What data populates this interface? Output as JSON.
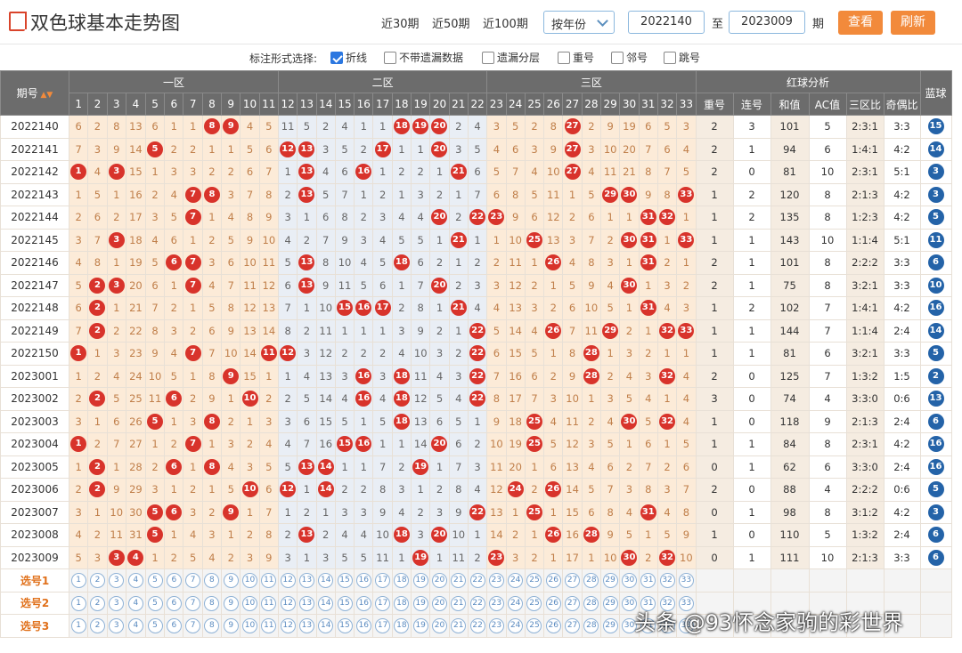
{
  "header": {
    "title": "双色球基本走势图",
    "ranges": [
      "近30期",
      "近50期",
      "近100期"
    ],
    "select": "按年份",
    "from": "2022140",
    "to_label": "至",
    "to": "2023009",
    "unit": "期",
    "view": "查看",
    "refresh": "刷新"
  },
  "options": {
    "label": "标注形式选择:",
    "items": [
      {
        "label": "折线",
        "checked": true
      },
      {
        "label": "不带遗漏数据",
        "checked": false
      },
      {
        "label": "遗漏分层",
        "checked": false
      },
      {
        "label": "重号",
        "checked": false
      },
      {
        "label": "邻号",
        "checked": false
      },
      {
        "label": "跳号",
        "checked": false
      }
    ]
  },
  "table": {
    "period_header": "期号",
    "zones": [
      "一区",
      "二区",
      "三区"
    ],
    "analysis_header": "红球分析",
    "blue_header": "蓝球",
    "analysis_cols": [
      "重号",
      "连号",
      "和值",
      "AC值",
      "三区比",
      "奇偶比"
    ],
    "select_rows": [
      "选号1",
      "选号2",
      "选号3"
    ],
    "rows": [
      {
        "p": "2022140",
        "r": [
          6,
          2,
          8,
          13,
          6,
          1,
          1,
          "#8",
          "#9",
          4,
          5,
          11,
          5,
          2,
          4,
          1,
          1,
          "#18",
          "#19",
          "#20",
          2,
          4,
          3,
          5,
          2,
          8,
          "#27",
          2,
          9,
          19,
          6,
          5,
          3
        ],
        "a": [
          2,
          3,
          101,
          5,
          "2:3:1",
          "3:3"
        ],
        "b": 15
      },
      {
        "p": "2022141",
        "r": [
          7,
          3,
          9,
          14,
          "#5",
          2,
          2,
          1,
          1,
          5,
          6,
          "#12",
          "#13",
          3,
          5,
          2,
          "#17",
          1,
          1,
          "#20",
          3,
          5,
          4,
          6,
          3,
          9,
          "#27",
          3,
          10,
          20,
          7,
          6,
          4
        ],
        "a": [
          2,
          1,
          94,
          6,
          "1:4:1",
          "4:2"
        ],
        "b": 14
      },
      {
        "p": "2022142",
        "r": [
          "#1",
          4,
          "#3",
          15,
          1,
          3,
          3,
          2,
          2,
          6,
          7,
          1,
          "#13",
          4,
          6,
          "#16",
          1,
          2,
          2,
          1,
          "#21",
          6,
          5,
          7,
          4,
          10,
          "#27",
          4,
          11,
          21,
          8,
          7,
          5
        ],
        "a": [
          2,
          0,
          81,
          10,
          "2:3:1",
          "5:1"
        ],
        "b": 3
      },
      {
        "p": "2022143",
        "r": [
          1,
          5,
          1,
          16,
          2,
          4,
          "#7",
          "#8",
          3,
          7,
          8,
          2,
          "#13",
          5,
          7,
          1,
          2,
          1,
          3,
          2,
          1,
          7,
          6,
          8,
          5,
          11,
          1,
          5,
          "#29",
          "#30",
          9,
          8,
          "#33"
        ],
        "a": [
          1,
          2,
          120,
          8,
          "2:1:3",
          "4:2"
        ],
        "b": 3
      },
      {
        "p": "2022144",
        "r": [
          2,
          6,
          2,
          17,
          3,
          5,
          "#7",
          1,
          4,
          8,
          9,
          3,
          1,
          6,
          8,
          2,
          3,
          4,
          4,
          "#20",
          2,
          "#22",
          "#23",
          9,
          6,
          12,
          2,
          6,
          1,
          1,
          "#31",
          "#32",
          1
        ],
        "a": [
          1,
          2,
          135,
          8,
          "1:2:3",
          "4:2"
        ],
        "b": 5
      },
      {
        "p": "2022145",
        "r": [
          3,
          7,
          "#3",
          18,
          4,
          6,
          1,
          2,
          5,
          9,
          10,
          4,
          2,
          7,
          9,
          3,
          4,
          5,
          5,
          1,
          "#21",
          1,
          1,
          10,
          "#25",
          13,
          3,
          7,
          2,
          "#30",
          "#31",
          1,
          "#33"
        ],
        "a": [
          1,
          1,
          143,
          10,
          "1:1:4",
          "5:1"
        ],
        "b": 11
      },
      {
        "p": "2022146",
        "r": [
          4,
          8,
          1,
          19,
          5,
          "#6",
          "#7",
          3,
          6,
          10,
          11,
          5,
          "#13",
          8,
          10,
          4,
          5,
          "#18",
          6,
          2,
          1,
          2,
          2,
          11,
          1,
          "#26",
          4,
          8,
          3,
          1,
          "#31",
          2,
          1
        ],
        "a": [
          2,
          1,
          101,
          8,
          "2:2:2",
          "3:3"
        ],
        "b": 6
      },
      {
        "p": "2022147",
        "r": [
          5,
          "#2",
          "#3",
          20,
          6,
          1,
          "#7",
          4,
          7,
          11,
          12,
          6,
          "#13",
          9,
          11,
          5,
          6,
          1,
          7,
          "#20",
          2,
          3,
          3,
          12,
          2,
          1,
          5,
          9,
          4,
          "#30",
          1,
          3,
          2
        ],
        "a": [
          2,
          1,
          75,
          8,
          "3:2:1",
          "3:3"
        ],
        "b": 10
      },
      {
        "p": "2022148",
        "r": [
          6,
          "#2",
          1,
          21,
          7,
          2,
          1,
          5,
          8,
          12,
          13,
          7,
          1,
          10,
          "#15",
          "#16",
          "#17",
          2,
          8,
          1,
          "#21",
          4,
          4,
          13,
          3,
          2,
          6,
          10,
          5,
          1,
          "#31",
          4,
          3
        ],
        "a": [
          1,
          2,
          102,
          7,
          "1:4:1",
          "4:2"
        ],
        "b": 16
      },
      {
        "p": "2022149",
        "r": [
          7,
          "#2",
          2,
          22,
          8,
          3,
          2,
          6,
          9,
          13,
          14,
          8,
          2,
          11,
          1,
          1,
          1,
          3,
          9,
          2,
          1,
          "#22",
          5,
          14,
          4,
          "#26",
          7,
          11,
          "#29",
          2,
          1,
          "#32",
          "#33"
        ],
        "a": [
          1,
          1,
          144,
          7,
          "1:1:4",
          "2:4"
        ],
        "b": 14
      },
      {
        "p": "2022150",
        "r": [
          "#1",
          1,
          3,
          23,
          9,
          4,
          "#7",
          7,
          10,
          14,
          "#11",
          "#12",
          3,
          12,
          2,
          2,
          2,
          4,
          10,
          3,
          2,
          "#22",
          6,
          15,
          5,
          1,
          8,
          "#28",
          1,
          3,
          2,
          1,
          1
        ],
        "a": [
          1,
          1,
          81,
          6,
          "3:2:1",
          "3:3"
        ],
        "b": 5
      },
      {
        "p": "2023001",
        "r": [
          1,
          2,
          4,
          24,
          10,
          5,
          1,
          8,
          "#9",
          15,
          1,
          1,
          4,
          13,
          3,
          "#16",
          3,
          "#18",
          11,
          4,
          3,
          "#22",
          7,
          16,
          6,
          2,
          9,
          "#28",
          2,
          4,
          3,
          "#32",
          4
        ],
        "a": [
          2,
          0,
          125,
          7,
          "1:3:2",
          "1:5"
        ],
        "b": 2
      },
      {
        "p": "2023002",
        "r": [
          2,
          "#2",
          5,
          25,
          11,
          "#6",
          2,
          9,
          1,
          "#10",
          2,
          2,
          5,
          14,
          4,
          "#16",
          4,
          "#18",
          12,
          5,
          4,
          "#22",
          8,
          17,
          7,
          3,
          10,
          1,
          3,
          5,
          4,
          1,
          4
        ],
        "a": [
          3,
          0,
          74,
          4,
          "3:3:0",
          "0:6"
        ],
        "b": 13
      },
      {
        "p": "2023003",
        "r": [
          3,
          1,
          6,
          26,
          "#5",
          1,
          3,
          "#8",
          2,
          1,
          3,
          3,
          6,
          15,
          5,
          1,
          5,
          "#18",
          13,
          6,
          5,
          1,
          9,
          18,
          "#25",
          4,
          11,
          2,
          4,
          "#30",
          5,
          "#32",
          4
        ],
        "a": [
          1,
          0,
          118,
          9,
          "2:1:3",
          "2:4"
        ],
        "b": 6
      },
      {
        "p": "2023004",
        "r": [
          "#1",
          2,
          7,
          27,
          1,
          2,
          "#7",
          1,
          3,
          2,
          4,
          4,
          7,
          16,
          "#15",
          "#16",
          1,
          1,
          14,
          "#20",
          6,
          2,
          10,
          19,
          "#25",
          5,
          12,
          3,
          5,
          1,
          6,
          1,
          5
        ],
        "a": [
          1,
          1,
          84,
          8,
          "2:3:1",
          "4:2"
        ],
        "b": 16
      },
      {
        "p": "2023005",
        "r": [
          1,
          "#2",
          1,
          28,
          2,
          "#6",
          1,
          "#8",
          4,
          3,
          5,
          5,
          "#13",
          "#14",
          1,
          1,
          7,
          2,
          "#19",
          1,
          7,
          3,
          11,
          20,
          1,
          6,
          13,
          4,
          6,
          2,
          7,
          2,
          6
        ],
        "a": [
          0,
          1,
          62,
          6,
          "3:3:0",
          "2:4"
        ],
        "b": 16
      },
      {
        "p": "2023006",
        "r": [
          2,
          "#2",
          9,
          29,
          3,
          1,
          2,
          1,
          5,
          "#10",
          6,
          "#12",
          1,
          "#14",
          2,
          2,
          8,
          3,
          1,
          2,
          8,
          4,
          12,
          "#24",
          2,
          "#26",
          14,
          5,
          7,
          3,
          8,
          3,
          7
        ],
        "a": [
          2,
          0,
          88,
          4,
          "2:2:2",
          "0:6"
        ],
        "b": 5
      },
      {
        "p": "2023007",
        "r": [
          3,
          1,
          10,
          30,
          "#5",
          "#6",
          3,
          2,
          "#9",
          1,
          7,
          1,
          2,
          1,
          3,
          3,
          9,
          4,
          2,
          3,
          9,
          "#22",
          13,
          1,
          "#25",
          1,
          15,
          6,
          8,
          4,
          "#31",
          4,
          8
        ],
        "a": [
          0,
          1,
          98,
          8,
          "3:1:2",
          "4:2"
        ],
        "b": 3
      },
      {
        "p": "2023008",
        "r": [
          4,
          2,
          11,
          31,
          "#5",
          1,
          4,
          3,
          1,
          2,
          8,
          2,
          "#13",
          2,
          4,
          4,
          10,
          "#18",
          3,
          "#20",
          10,
          1,
          14,
          2,
          1,
          "#26",
          16,
          "#28",
          9,
          5,
          1,
          5,
          9
        ],
        "a": [
          1,
          0,
          110,
          5,
          "1:3:2",
          "2:4"
        ],
        "b": 6
      },
      {
        "p": "2023009",
        "r": [
          5,
          3,
          "#3",
          "#4",
          1,
          2,
          5,
          4,
          2,
          3,
          9,
          3,
          1,
          3,
          5,
          5,
          11,
          1,
          "#19",
          1,
          11,
          2,
          "#23",
          3,
          2,
          1,
          17,
          1,
          10,
          "#30",
          2,
          "#32",
          10
        ],
        "a": [
          0,
          1,
          111,
          10,
          "2:1:3",
          "3:3"
        ],
        "b": 6
      }
    ]
  },
  "watermark": "头条 @93怀念家驹的彩世界"
}
